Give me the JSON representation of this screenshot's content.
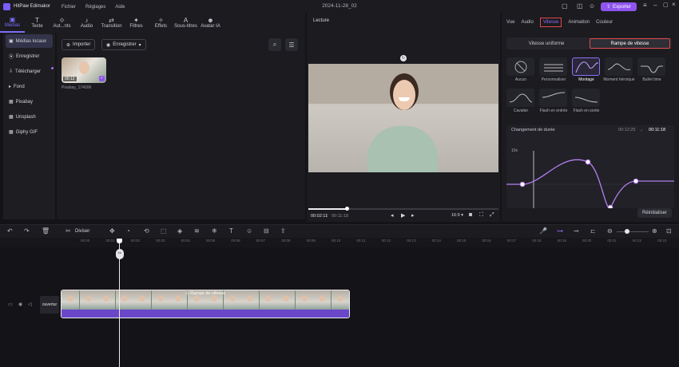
{
  "app": {
    "name": "HitPaw Edimakor",
    "project": "2024-11-28_02",
    "export_label": "Exporter"
  },
  "menu": [
    "Fichier",
    "Réglages",
    "Aide"
  ],
  "toolbar": [
    {
      "label": "Médias",
      "icon": "media-icon"
    },
    {
      "label": "Texte",
      "icon": "text-icon"
    },
    {
      "label": "Aut...nts",
      "icon": "auto-icon"
    },
    {
      "label": "Audio",
      "icon": "audio-icon"
    },
    {
      "label": "Transition",
      "icon": "transition-icon"
    },
    {
      "label": "Filtres",
      "icon": "filter-icon"
    },
    {
      "label": "Effets",
      "icon": "effects-icon"
    },
    {
      "label": "Sous-titres",
      "icon": "subtitles-icon"
    },
    {
      "label": "Avatar IA",
      "icon": "avatar-icon"
    }
  ],
  "sidebar": [
    "Médias locaux",
    "Enregistrer",
    "Télécharger",
    "Fond",
    "Pixabay",
    "Unsplash",
    "Giphy GIF"
  ],
  "media": {
    "import_label": "Importer",
    "record_label": "Enregistrer",
    "item": {
      "name": "Pixabay_174006",
      "duration": "00:12"
    }
  },
  "player": {
    "title": "Lecture",
    "current": "00:02:11",
    "total": "00:11:18",
    "ratio": "16:9",
    "progress": 0.2
  },
  "right": {
    "tabs": [
      "Vue",
      "Audio",
      "Vitesse",
      "Animation",
      "Couleur"
    ],
    "modes": [
      "Vitesse uniforme",
      "Rampe de vitesse"
    ],
    "presets": [
      "Aucun",
      "Personnaliser",
      "Montage",
      "Moment héroïque",
      "Bullet time",
      "Cavalier",
      "Flash en entrée",
      "Flash en sortie"
    ],
    "duration_label": "Changement de durée",
    "old_duration": "00:12:25",
    "new_duration": "00:11:18",
    "ylabel": "10x",
    "reset_label": "Réinitialiser"
  },
  "timeline": {
    "split_label": "Diviser",
    "clip_label": "Rampe de vitesse",
    "track_label": "ouvertur",
    "ticks": [
      "00:00",
      "00:01",
      "00:02",
      "00:03",
      "00:04",
      "00:05",
      "00:06",
      "00:07",
      "00:08",
      "00:09",
      "00:10",
      "00:11",
      "00:12",
      "00:13",
      "00:14",
      "00:15",
      "00:16",
      "00:17",
      "00:18",
      "00:19",
      "00:20",
      "00:21",
      "00:22",
      "00:23",
      "00:24"
    ]
  }
}
